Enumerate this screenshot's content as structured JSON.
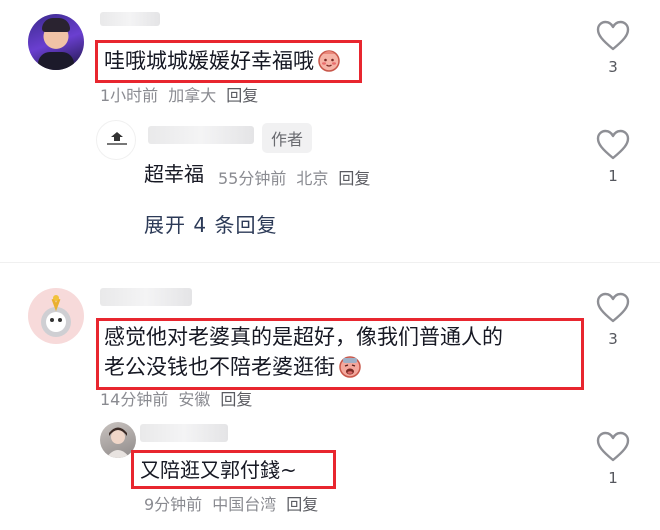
{
  "comments": [
    {
      "text": "哇哦城城媛媛好幸福哦",
      "time": "1小时前",
      "location": "加拿大",
      "reply": "回复",
      "likes": "3"
    },
    {
      "badge": "作者",
      "text": "超幸福",
      "time": "55分钟前",
      "location": "北京",
      "reply": "回复",
      "likes": "1"
    },
    {
      "expand": "展开 4 条回复"
    },
    {
      "line1": "感觉他对老婆真的是超好，像我们普通人的",
      "line2": "老公没钱也不陪老婆逛街",
      "time": "14分钟前",
      "location": "安徽",
      "reply": "回复",
      "likes": "3"
    },
    {
      "text": "又陪逛又郭付錢~",
      "time": "9分钟前",
      "location": "中国台湾",
      "reply": "回复",
      "likes": "1"
    }
  ],
  "icons": [
    "heart-outline-icon",
    "blush-emoji-icon",
    "cry-emoji-icon"
  ],
  "colors": {
    "highlight": "#e8262f",
    "meta": "#8a8b91",
    "text": "#161823"
  }
}
